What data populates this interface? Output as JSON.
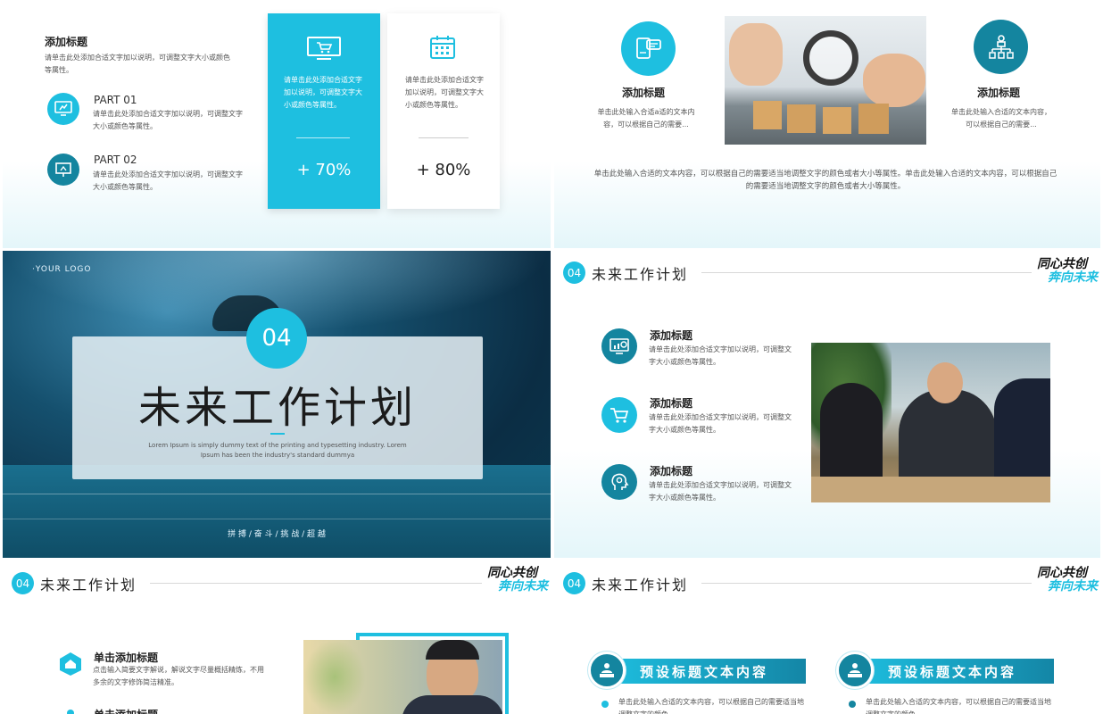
{
  "slide1": {
    "title": "添加标题",
    "desc": "请单击此处添加合适文字加以说明，可调整文字大小或颜色等属性。",
    "parts": [
      {
        "label": "PART  01",
        "desc": "请单击此处添加合适文字加以说明，可调整文字大小或颜色等属性。",
        "icon": "monitor-icon"
      },
      {
        "label": "PART  02",
        "desc": "请单击此处添加合适文字加以说明，可调整文字大小或颜色等属性。",
        "icon": "presentation-icon"
      }
    ],
    "cards": [
      {
        "text": "请单击此处添加合适文字加以说明，可调整文字大小或颜色等属性。",
        "value": "+  70%",
        "icon": "cart-monitor-icon",
        "percent": 70
      },
      {
        "text": "请单击此处添加合适文字加以说明，可调整文字大小或颜色等属性。",
        "value": "+  80%",
        "icon": "calendar-icon",
        "percent": 80
      }
    ]
  },
  "slide2": {
    "left": {
      "title": "添加标题",
      "desc": "单击此处输入合适a适的文本内容，可以根据自己的需要...",
      "icon": "chat-device-icon"
    },
    "right": {
      "title": "添加标题",
      "desc": "单击此处输入合适的文本内容，可以根据自己的需要...",
      "icon": "org-chart-icon"
    },
    "bottom": "单击此处输入合适的文本内容，可以根据自己的需要适当地调整文字的颜色或者大小等属性。单击此处输入合适的文本内容，可以根据自己的需要适当地调整文字的颜色或者大小等属性。"
  },
  "slide3": {
    "logo": "·YOUR  LOGO",
    "number": "04",
    "title": "未来工作计划",
    "subtitle": "Lorem Ipsum is simply dummy text of the printing and typesetting industry. Lorem Ipsum has been the industry's standard dummya",
    "motto": "拼    搏    /    奋    斗    /    挑    战    /    超    越"
  },
  "section": {
    "number": "04",
    "title": "未来工作计划",
    "brand_line1": "同心共创",
    "brand_line2": "奔向未来"
  },
  "slide4": {
    "items": [
      {
        "title": "添加标题",
        "desc": "请单击此处添加合适文字加以说明，可调整文字大小或颜色等属性。",
        "icon": "chart-screen-icon"
      },
      {
        "title": "添加标题",
        "desc": "请单击此处添加合适文字加以说明，可调整文字大小或颜色等属性。",
        "icon": "cart-icon"
      },
      {
        "title": "添加标题",
        "desc": "请单击此处添加合适文字加以说明，可调整文字大小或颜色等属性。",
        "icon": "head-gear-icon"
      }
    ]
  },
  "slide5": {
    "items": [
      {
        "title": "单击添加标题",
        "desc": "点击输入简要文字解说，解说文字尽量概括精炼，不用多余的文字修饰简洁精准。",
        "icon": "home-icon"
      },
      {
        "title": "单击添加标题",
        "desc": "",
        "icon": "bullet-icon"
      }
    ]
  },
  "slide6": {
    "ribbons": [
      {
        "title": "预设标题文本内容",
        "desc": "单击此处输入合适的文本内容，可以根据自己的需要适当地调整文字的颜色",
        "icon": "presenter-icon"
      },
      {
        "title": "预设标题文本内容",
        "desc": "单击此处输入合适的文本内容，可以根据自己的需要适当地调整文字的颜色",
        "icon": "presenter-icon"
      }
    ]
  },
  "colors": {
    "accent": "#1ebfe0",
    "dark_teal": "#14859f"
  }
}
